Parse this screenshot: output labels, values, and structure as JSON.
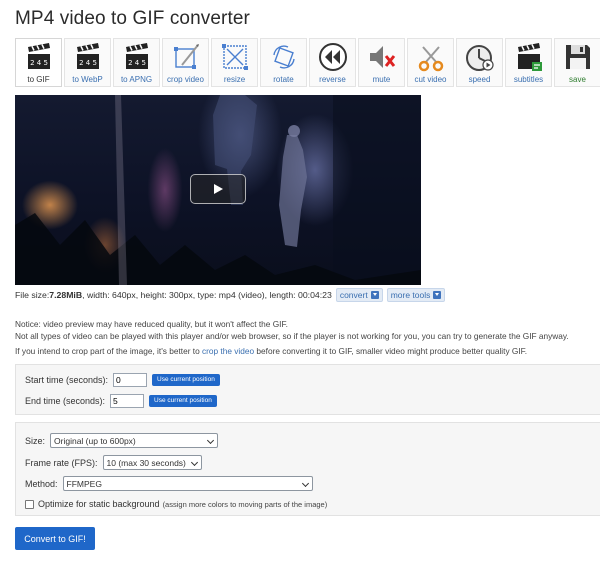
{
  "page": {
    "title": "MP4 video to GIF converter"
  },
  "toolbar": {
    "tools": [
      {
        "label": "to GIF",
        "icon": "clapperboard-icon"
      },
      {
        "label": "to WebP",
        "icon": "clapperboard-icon"
      },
      {
        "label": "to APNG",
        "icon": "clapperboard-icon"
      },
      {
        "label": "crop video",
        "icon": "crop-icon"
      },
      {
        "label": "resize",
        "icon": "resize-icon"
      },
      {
        "label": "rotate",
        "icon": "rotate-icon"
      },
      {
        "label": "reverse",
        "icon": "reverse-icon"
      },
      {
        "label": "mute",
        "icon": "mute-icon"
      },
      {
        "label": "cut video",
        "icon": "scissors-icon"
      },
      {
        "label": "speed",
        "icon": "speed-icon"
      },
      {
        "label": "subtitles",
        "icon": "subtitles-icon"
      },
      {
        "label": "save",
        "icon": "save-icon"
      }
    ]
  },
  "file_info": {
    "size_label": "File size: ",
    "size_value": "7.28MiB",
    "details": ", width: 640px, height: 300px, type: mp4 (video), length: 00:04:23",
    "convert_label": "convert",
    "more_tools_label": "more tools"
  },
  "notice": {
    "line1": "Notice: video preview may have reduced quality, but it won't affect the GIF.",
    "line2": "Not all types of video can be played with this player and/or web browser, so if the player is not working for you, you can try to generate the GIF anyway.",
    "line3_before": "If you intend to crop part of the image, it's better to ",
    "line3_link": "crop the video",
    "line3_after": " before converting it to GIF, smaller video might produce better quality GIF."
  },
  "time": {
    "start_label": "Start time (seconds):",
    "start_value": "0",
    "end_label": "End time (seconds):",
    "end_value": "5",
    "use_position_label": "Use current position"
  },
  "options": {
    "size_label": "Size:",
    "size_value": "Original (up to 600px)",
    "fps_label": "Frame rate (FPS):",
    "fps_value": "10 (max 30 seconds)",
    "method_label": "Method:",
    "method_value": "FFMPEG",
    "optimize_label": "Optimize for static background",
    "optimize_hint": "(assign more colors to moving parts of the image)"
  },
  "actions": {
    "convert_label": "Convert to GIF!"
  },
  "colors": {
    "accent": "#1f67c9",
    "link": "#3a6fb0"
  }
}
